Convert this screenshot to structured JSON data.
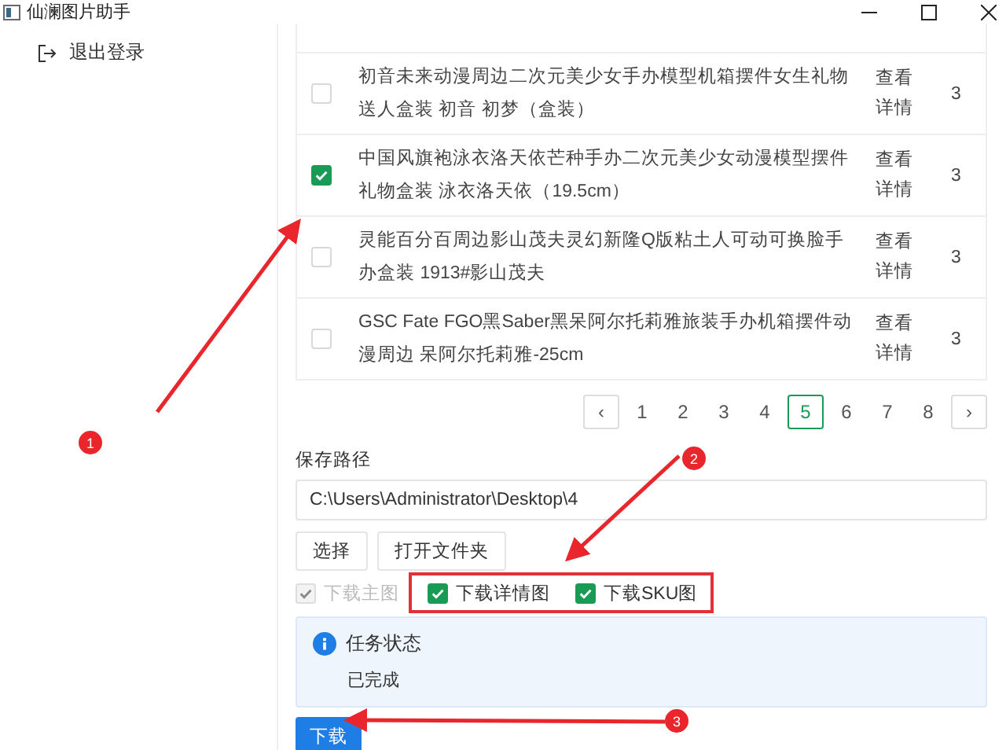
{
  "window": {
    "title": "仙澜图片助手"
  },
  "sidebar": {
    "items": [
      {
        "label": "退出登录"
      }
    ]
  },
  "table": {
    "rows": [
      {
        "title": "初音未来动漫周边二次元美少女手办模型机箱摆件女生礼物送人盒装 初音 初梦（盒装）",
        "action": "查看详情",
        "count": "3",
        "checked": false
      },
      {
        "title": "中国风旗袍泳衣洛天依芒种手办二次元美少女动漫模型摆件礼物盒装 泳衣洛天依（19.5cm）",
        "action": "查看详情",
        "count": "3",
        "checked": true
      },
      {
        "title": "灵能百分百周边影山茂夫灵幻新隆Q版粘土人可动可换脸手办盒装 1913#影山茂夫",
        "action": "查看详情",
        "count": "3",
        "checked": false
      },
      {
        "title": "GSC Fate FGO黑Saber黑呆阿尔托莉雅旅装手办机箱摆件动漫周边 呆阿尔托莉雅-25cm",
        "action": "查看详情",
        "count": "3",
        "checked": false
      }
    ]
  },
  "pagination": {
    "prev": "‹",
    "next": "›",
    "pages": [
      {
        "label": "1",
        "selected": false
      },
      {
        "label": "2",
        "selected": false
      },
      {
        "label": "3",
        "selected": false
      },
      {
        "label": "4",
        "selected": false
      },
      {
        "label": "5",
        "selected": true
      },
      {
        "label": "6",
        "selected": false
      },
      {
        "label": "7",
        "selected": false
      },
      {
        "label": "8",
        "selected": false
      }
    ]
  },
  "save_path": {
    "label": "保存路径",
    "value": "C:\\Users\\Administrator\\Desktop\\4",
    "buttons": [
      "选择",
      "打开文件夹"
    ]
  },
  "options": [
    {
      "label": "下载主图",
      "checked": true,
      "disabled": true,
      "highlighted": false
    },
    {
      "label": "下载详情图",
      "checked": true,
      "disabled": false,
      "highlighted": true
    },
    {
      "label": "下载SKU图",
      "checked": true,
      "disabled": false,
      "highlighted": true
    }
  ],
  "status": {
    "title": "任务状态",
    "message": "已完成"
  },
  "download_button": "下载",
  "annotations": [
    {
      "number": "1"
    },
    {
      "number": "2"
    },
    {
      "number": "3"
    }
  ]
}
